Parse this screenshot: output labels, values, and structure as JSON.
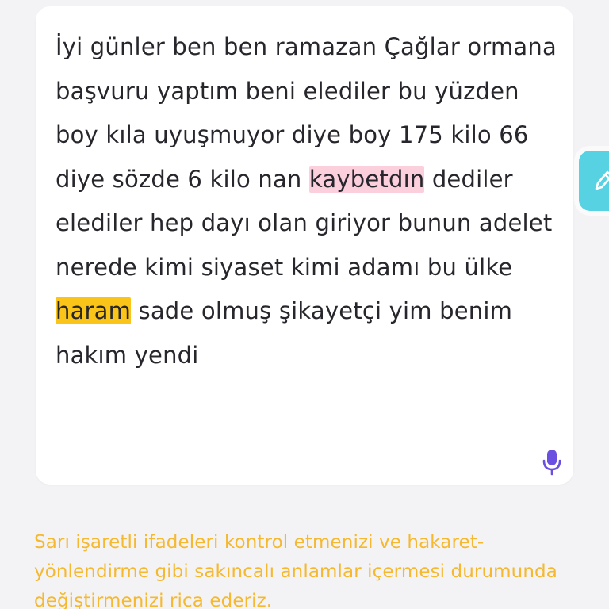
{
  "complaint": {
    "text_part1": "İyi günler ben ben ramazan Çağlar ormana başvuru yaptım beni elediler bu yüzden boy kıla uyuşmuyor diye boy 175 kilo 66 diye sözde 6 kilo nan ",
    "highlight_spelling": "kaybetdın",
    "text_part2": " dediler elediler hep dayı olan giriyor bunun adelet nerede kimi siyaset kimi adamı bu ülke ",
    "highlight_flagged": "haram",
    "text_part3": " sade olmuş şikayetçi yim benim hakım yendi"
  },
  "icons": {
    "mic": "microphone-icon",
    "edit": "pencil-icon"
  },
  "colors": {
    "accent_purple": "#6b4fe0",
    "fab_cyan": "#56d2e3",
    "warning_yellow": "#f5b82e",
    "highlight_pink": "#fbd0dc",
    "highlight_yellow": "#fbc419"
  },
  "warning": {
    "message": "Sarı işaretli ifadeleri kontrol etmenizi ve hakaret-yönlendirme gibi sakıncalı anlamlar içermesi durumunda değiştirmenizi rica ederiz."
  }
}
